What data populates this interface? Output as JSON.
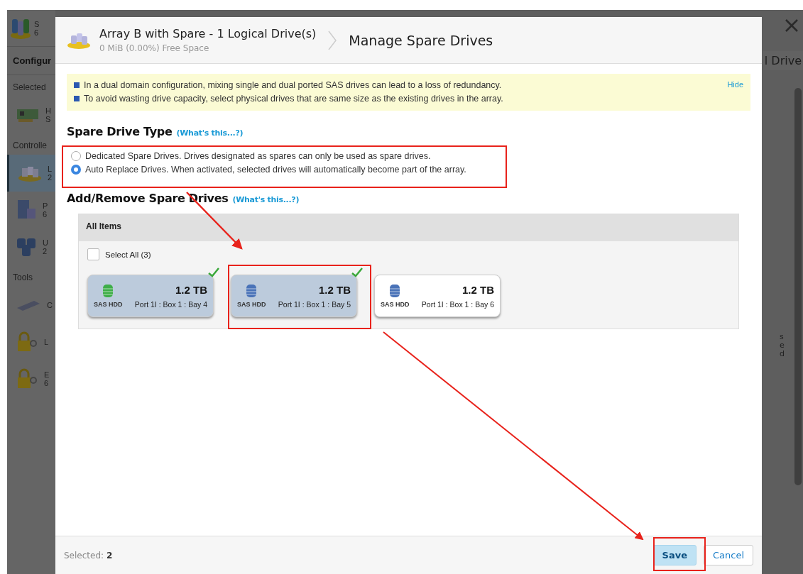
{
  "background": {
    "app_header": {
      "title": "S",
      "subtitle": "6"
    },
    "sidebar": [
      {
        "kind": "heading",
        "label": "Configur"
      },
      {
        "kind": "group",
        "label": "Selected"
      },
      {
        "kind": "controller",
        "label": "H",
        "sublabel": "S",
        "selected": false
      },
      {
        "kind": "group",
        "label": "Controlle"
      },
      {
        "kind": "array",
        "label": "L",
        "sublabel": "2",
        "selected": true
      },
      {
        "kind": "server",
        "label": "P",
        "sublabel": "6",
        "selected": false
      },
      {
        "kind": "disks",
        "label": "U",
        "sublabel": "2",
        "selected": false
      },
      {
        "kind": "group",
        "label": "Tools"
      },
      {
        "kind": "enclosure",
        "label": "C",
        "selected": false
      },
      {
        "kind": "license",
        "label": "L",
        "selected": false
      },
      {
        "kind": "license",
        "label": "E",
        "sublabel": "6",
        "selected": false
      }
    ],
    "right_tab": "l Drive",
    "right_texts": [
      "s",
      "e",
      "d"
    ]
  },
  "dialog": {
    "title": "Array B with Spare - 1 Logical Drive(s)",
    "subtitle": "0 MiB (0.00%) Free Space",
    "page_title": "Manage Spare Drives",
    "notice": {
      "lines": [
        "In a dual domain configuration, mixing single and dual ported SAS drives can lead to a loss of redundancy.",
        "To avoid wasting drive capacity, select physical drives that are same size as the existing drives in the array."
      ],
      "hide_link": "Hide"
    },
    "spare_type": {
      "heading": "Spare Drive Type",
      "help_link": "(What's this...?)",
      "options": [
        {
          "label": "Dedicated Spare Drives. Drives designated as spares can only be used as spare drives.",
          "selected": false
        },
        {
          "label": "Auto Replace Drives. When activated, selected drives will automatically become part of the array.",
          "selected": true
        }
      ]
    },
    "spare_drives": {
      "heading": "Add/Remove Spare Drives",
      "help_link": "(What's this...?)",
      "panel_title": "All Items",
      "select_all": {
        "label": "Select All (3)",
        "checked": false
      },
      "drives": [
        {
          "capacity": "1.2 TB",
          "type": "SAS HDD",
          "location": "Port 1I : Box 1 : Bay 4",
          "color": "#3fae49",
          "selected": true
        },
        {
          "capacity": "1.2 TB",
          "type": "SAS HDD",
          "location": "Port 1I : Box 1 : Bay 5",
          "color": "#4a73b8",
          "selected": true
        },
        {
          "capacity": "1.2 TB",
          "type": "SAS HDD",
          "location": "Port 1I : Box 1 : Bay 6",
          "color": "#4a73b8",
          "selected": false
        }
      ]
    },
    "footer": {
      "selected_label": "Selected:",
      "selected_count": "2",
      "buttons": [
        {
          "kind": "primary",
          "label": "Save"
        },
        {
          "kind": "secondary",
          "label": "Cancel"
        }
      ]
    }
  }
}
